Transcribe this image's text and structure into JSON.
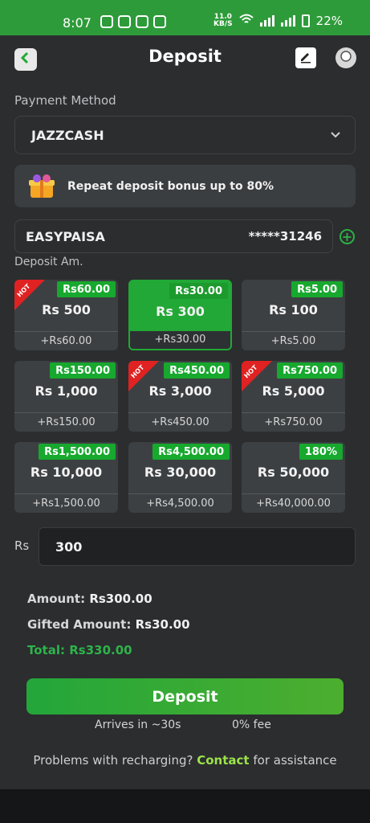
{
  "status_bar": {
    "time": "8:07",
    "speed_value": "11.0",
    "speed_unit": "KB/S",
    "battery": "22%"
  },
  "header": {
    "title": "Deposit",
    "back_icon": "back-arrow-icon",
    "edit_icon": "edit-icon",
    "support_icon": "support-icon"
  },
  "payment": {
    "label": "Payment Method",
    "selected": "JAZZCASH",
    "bonus_text": "Repeat deposit bonus up to 80%",
    "account_name": "EASYPAISA",
    "account_number": "*****31246",
    "deposit_label": "Deposit Am."
  },
  "tiles": [
    {
      "bonus": "Rs60.00",
      "amount": "Rs 500",
      "gift": "+Rs60.00",
      "hot": true,
      "selected": false
    },
    {
      "bonus": "Rs30.00",
      "amount": "Rs 300",
      "gift": "+Rs30.00",
      "hot": false,
      "selected": true
    },
    {
      "bonus": "Rs5.00",
      "amount": "Rs 100",
      "gift": "+Rs5.00",
      "hot": false,
      "selected": false
    },
    {
      "bonus": "Rs150.00",
      "amount": "Rs 1,000",
      "gift": "+Rs150.00",
      "hot": false,
      "selected": false
    },
    {
      "bonus": "Rs450.00",
      "amount": "Rs 3,000",
      "gift": "+Rs450.00",
      "hot": true,
      "selected": false
    },
    {
      "bonus": "Rs750.00",
      "amount": "Rs 5,000",
      "gift": "+Rs750.00",
      "hot": true,
      "selected": false
    },
    {
      "bonus": "Rs1,500.00",
      "amount": "Rs 10,000",
      "gift": "+Rs1,500.00",
      "hot": false,
      "selected": false
    },
    {
      "bonus": "Rs4,500.00",
      "amount": "Rs 30,000",
      "gift": "+Rs4,500.00",
      "hot": false,
      "selected": false
    },
    {
      "bonus": "180%",
      "amount": "Rs 50,000",
      "gift": "+Rs40,000.00",
      "hot": false,
      "selected": false
    }
  ],
  "hot_label": "HOT",
  "input": {
    "currency": "Rs",
    "value": "300"
  },
  "summary": {
    "amount_label": "Amount:",
    "amount_value": "Rs300.00",
    "gifted_label": "Gifted Amount:",
    "gifted_value": "Rs30.00",
    "total_label": "Total:",
    "total_value": "Rs330.00"
  },
  "action": {
    "deposit_button": "Deposit",
    "arrives": "Arrives in ~30s",
    "fee": "0% fee"
  },
  "help": {
    "prefix": "Problems with recharging?",
    "link": "Contact",
    "suffix": "for assistance"
  },
  "colors": {
    "accent": "#22a836",
    "background": "#2b2d2f",
    "hot": "#e02222"
  }
}
